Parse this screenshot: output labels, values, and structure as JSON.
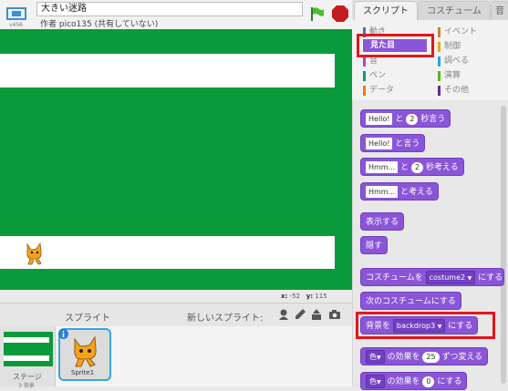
{
  "app": {
    "version": "v456",
    "project_title": "大きい迷路",
    "author": "作者 pico135 (共有していない)"
  },
  "stage": {
    "coords": {
      "x_label": "x:",
      "x_value": "-52",
      "y_label": "y:",
      "y_value": "115"
    }
  },
  "sprites": {
    "header": "スプライト",
    "new_sprite_label": "新しいスプライト:",
    "stage_label": "ステージ",
    "stage_sub": "3 背景",
    "items": [
      {
        "label": "Sprite1"
      }
    ]
  },
  "tabs": [
    {
      "label": "スクリプト",
      "active": true
    },
    {
      "label": "コスチューム",
      "active": false
    },
    {
      "label": "音",
      "active": false
    }
  ],
  "categories": {
    "left": [
      {
        "label": "動き",
        "color": "#4a6cd4"
      },
      {
        "label": "見た目",
        "color": "#8a55d7",
        "selected": true
      },
      {
        "label": "音",
        "color": "#bb42c3"
      },
      {
        "label": "ペン",
        "color": "#0e9a6c"
      },
      {
        "label": "データ",
        "color": "#ee7d16"
      }
    ],
    "right": [
      {
        "label": "イベント",
        "color": "#c88330"
      },
      {
        "label": "制御",
        "color": "#e1a91a"
      },
      {
        "label": "調べる",
        "color": "#2ca5e2"
      },
      {
        "label": "演算",
        "color": "#5cb712"
      },
      {
        "label": "その他",
        "color": "#632d99"
      }
    ]
  },
  "blocks": [
    {
      "input": "Hello!",
      "mid": "と",
      "num": "2",
      "end": "秒言う"
    },
    {
      "input": "Hello!",
      "end": "と言う"
    },
    {
      "input": "Hmm...",
      "mid": "と",
      "num": "2",
      "end": "秒考える"
    },
    {
      "input": "Hmm...",
      "end": "と考える"
    },
    {
      "text": "表示する"
    },
    {
      "text": "隠す"
    },
    {
      "pre": "コスチュームを",
      "drop": "costume2",
      "end": "にする"
    },
    {
      "text": "次のコスチュームにする"
    },
    {
      "pre": "背景を",
      "drop": "backdrop3",
      "end": "にする"
    },
    {
      "pre": "色",
      "mid": "の効果を",
      "num": "25",
      "end": "ずつ変える"
    },
    {
      "pre": "色",
      "mid": "の効果を",
      "num": "0",
      "end": "にする"
    }
  ],
  "colors": {
    "stage_green": "#0b9a3b",
    "looks_purple": "#8a55d7",
    "highlight_red": "#e3161d"
  }
}
